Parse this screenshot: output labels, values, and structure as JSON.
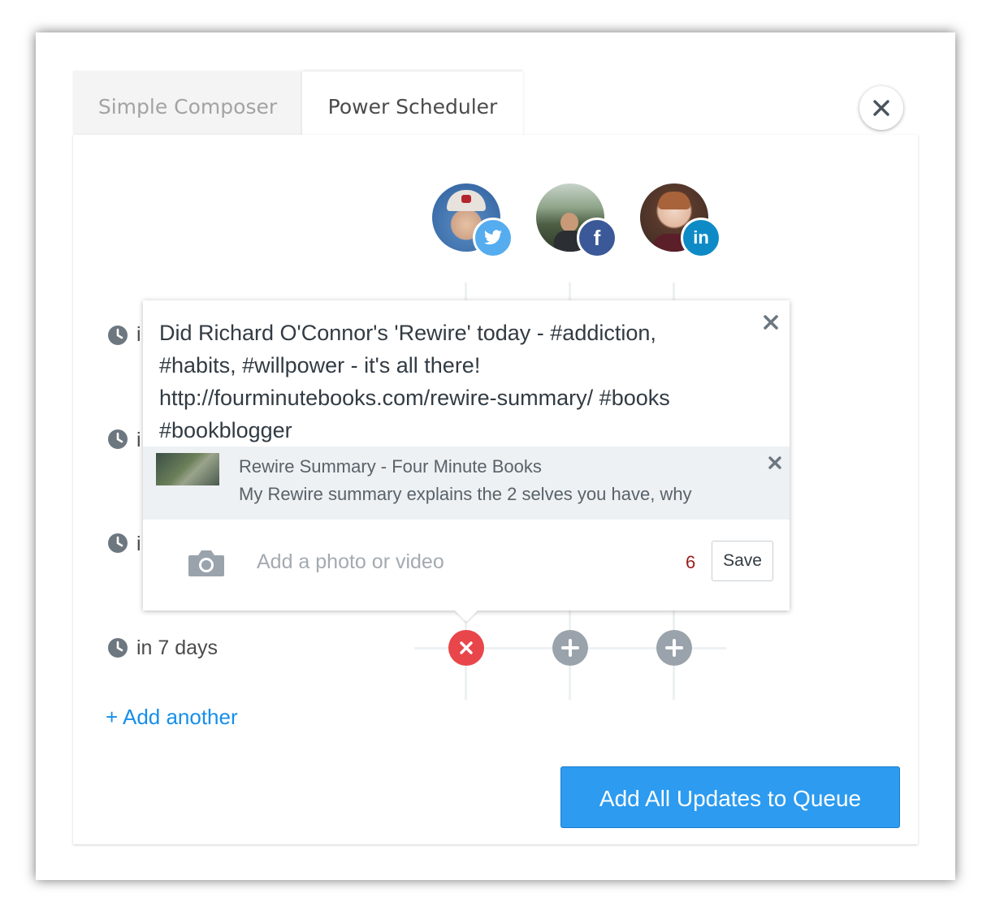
{
  "tabs": [
    {
      "label": "Simple Composer",
      "active": false
    },
    {
      "label": "Power Scheduler",
      "active": true
    }
  ],
  "profiles": [
    {
      "network": "twitter",
      "badge_icon": "twitter-icon",
      "badge_color": "#55acee"
    },
    {
      "network": "facebook",
      "badge_icon": "facebook-icon",
      "badge_label": "f",
      "badge_color": "#3b5998"
    },
    {
      "network": "linkedin",
      "badge_icon": "linkedin-icon",
      "badge_label": "in",
      "badge_color": "#0e8bc7"
    }
  ],
  "schedule_rows": [
    {
      "label": "i"
    },
    {
      "label": "i"
    },
    {
      "label": "i"
    },
    {
      "label": "in 7 days"
    }
  ],
  "add_another": "+ Add another",
  "queue_button": "Add All Updates to Queue",
  "post": {
    "text": "Did Richard O'Connor's 'Rewire' today - #addiction,\n#habits, #willpower - it's all there!\nhttp://fourminutebooks.com/rewire-summary/ #books\n#bookblogger",
    "link_title": "Rewire Summary - Four Minute Books",
    "link_description": "My Rewire summary explains the 2 selves you have, why",
    "media_placeholder": "Add a photo or video",
    "char_count": "6",
    "save_label": "Save"
  },
  "colors": {
    "accent": "#168eea",
    "button": "#2c9bf0",
    "remove": "#e8464b",
    "add_node": "#9aa3ab",
    "char_count": "#9b1c1c"
  }
}
